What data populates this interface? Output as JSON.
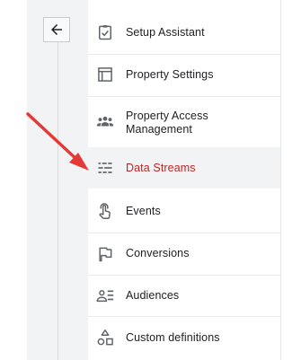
{
  "nav": {
    "back_label": "Back",
    "items": [
      {
        "label": "Setup Assistant",
        "icon": "clipboard-check-icon"
      },
      {
        "label": "Property Settings",
        "icon": "property-settings-icon"
      },
      {
        "label": "Property Access Management",
        "icon": "people-icon"
      },
      {
        "label": "Data Streams",
        "icon": "data-streams-icon",
        "active": true
      },
      {
        "label": "Events",
        "icon": "touch-icon"
      },
      {
        "label": "Conversions",
        "icon": "flag-icon"
      },
      {
        "label": "Audiences",
        "icon": "audiences-icon"
      },
      {
        "label": "Custom definitions",
        "icon": "shapes-icon"
      }
    ]
  },
  "colors": {
    "active_text": "#c5221f",
    "annotation_arrow": "#e53935",
    "icon": "#5f6368"
  }
}
